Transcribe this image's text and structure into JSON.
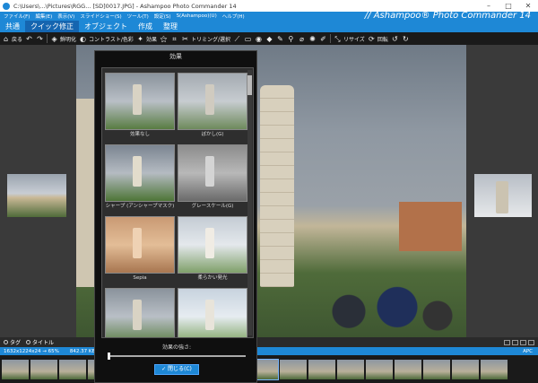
{
  "window": {
    "title": "C:\\Users\\...\\Pictures\\RGG... [SD]0017.JPG] - Ashampoo Photo Commander 14",
    "brand": "// Ashampoo® Photo Commander 14"
  },
  "menu": [
    "ファイル(F)",
    "編集(E)",
    "表示(V)",
    "スライドショー(S)",
    "ツール(T)",
    "設定(S)",
    "S(Ashampoo)(U)",
    "ヘルプ(H)"
  ],
  "tabs": [
    "共通",
    "クイック修正",
    "オブジェクト",
    "作成",
    "整理"
  ],
  "toolbar": {
    "back": "戻る",
    "sharpen": "鮮明化",
    "contrast": "コントラスト/色彩",
    "effects": "効果",
    "trim": "トリミング/選択",
    "resize": "リサイズ",
    "rotate": "回転"
  },
  "dialog": {
    "title": "効果",
    "effects": [
      {
        "label": "効果なし",
        "tower": "#d9d3c4",
        "bg": "linear-gradient(#8a939c,#b9bfc6 50%,#587c42)"
      },
      {
        "label": "ぼかし(G)",
        "tower": "#d0cbc0",
        "bg": "linear-gradient(#a4abb2,#c7ccd0 50%,#6e8a5c)"
      },
      {
        "label": "シャープ (アンシャープマスク)",
        "tower": "#e2dccc",
        "bg": "linear-gradient(#7b8591,#b5bbc2 50%,#4d7537)"
      },
      {
        "label": "グレースケール(G)",
        "tower": "#d4d4d4",
        "bg": "linear-gradient(#8c8c8c,#b8b8b8 50%,#6a6a6a)"
      },
      {
        "label": "Sepia",
        "tower": "#efd2b4",
        "bg": "linear-gradient(#c99a74,#e3bd97 50%,#a87650)"
      },
      {
        "label": "柔らかい発光",
        "tower": "#f0ece4",
        "bg": "linear-gradient(#c4ccd4,#e4e8ec 50%,#7fa06a)"
      },
      {
        "label": "",
        "tower": "#d9d3c4",
        "bg": "linear-gradient(#8a939c,#b9bfc6 50%,#587c42)"
      },
      {
        "label": "",
        "tower": "#e8e4da",
        "bg": "linear-gradient(#c8d3de,#e6ecf1 50%,#7aa15e)"
      }
    ],
    "strength_label": "効果の強さ:",
    "close_label": "✓ 閉じる(C)"
  },
  "bottombar": {
    "tag_label": "タグ",
    "title_label": "タイトル"
  },
  "status": {
    "left": "1632x1224x24 → 65%",
    "size": "842.37 KB",
    "right": "APC"
  }
}
